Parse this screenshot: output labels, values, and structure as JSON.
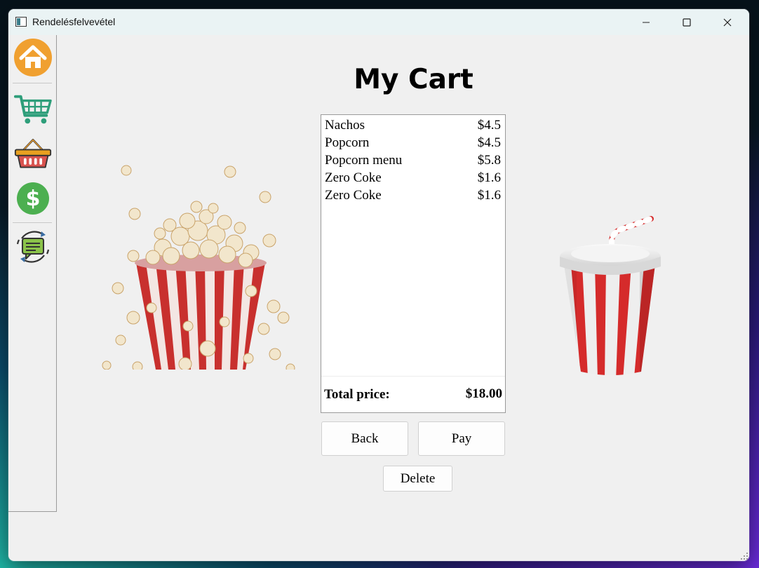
{
  "window": {
    "title": "Rendelésfelvevétel"
  },
  "sidebar": {
    "items": [
      {
        "icon": "home-icon"
      },
      {
        "icon": "shopping-cart-icon"
      },
      {
        "icon": "basket-icon"
      },
      {
        "icon": "dollar-icon"
      },
      {
        "icon": "feedback-chat-icon"
      }
    ]
  },
  "page": {
    "heading": "My Cart"
  },
  "cart": {
    "items": [
      {
        "name": "Nachos",
        "price": "$4.5"
      },
      {
        "name": "Popcorn",
        "price": "$4.5"
      },
      {
        "name": "Popcorn menu",
        "price": "$5.8"
      },
      {
        "name": "Zero Coke",
        "price": "$1.6"
      },
      {
        "name": "Zero Coke",
        "price": "$1.6"
      }
    ],
    "total_label": "Total price:",
    "total_value": "$18.00"
  },
  "buttons": {
    "back": "Back",
    "pay": "Pay",
    "delete": "Delete"
  },
  "images": {
    "left": "popcorn-image",
    "right": "soda-cup-image"
  },
  "colors": {
    "home": "#f0a030",
    "cart": "#2e9e7a",
    "basket": "#d9534f",
    "dollar": "#4caf50",
    "feedback": "#8bc34a"
  }
}
